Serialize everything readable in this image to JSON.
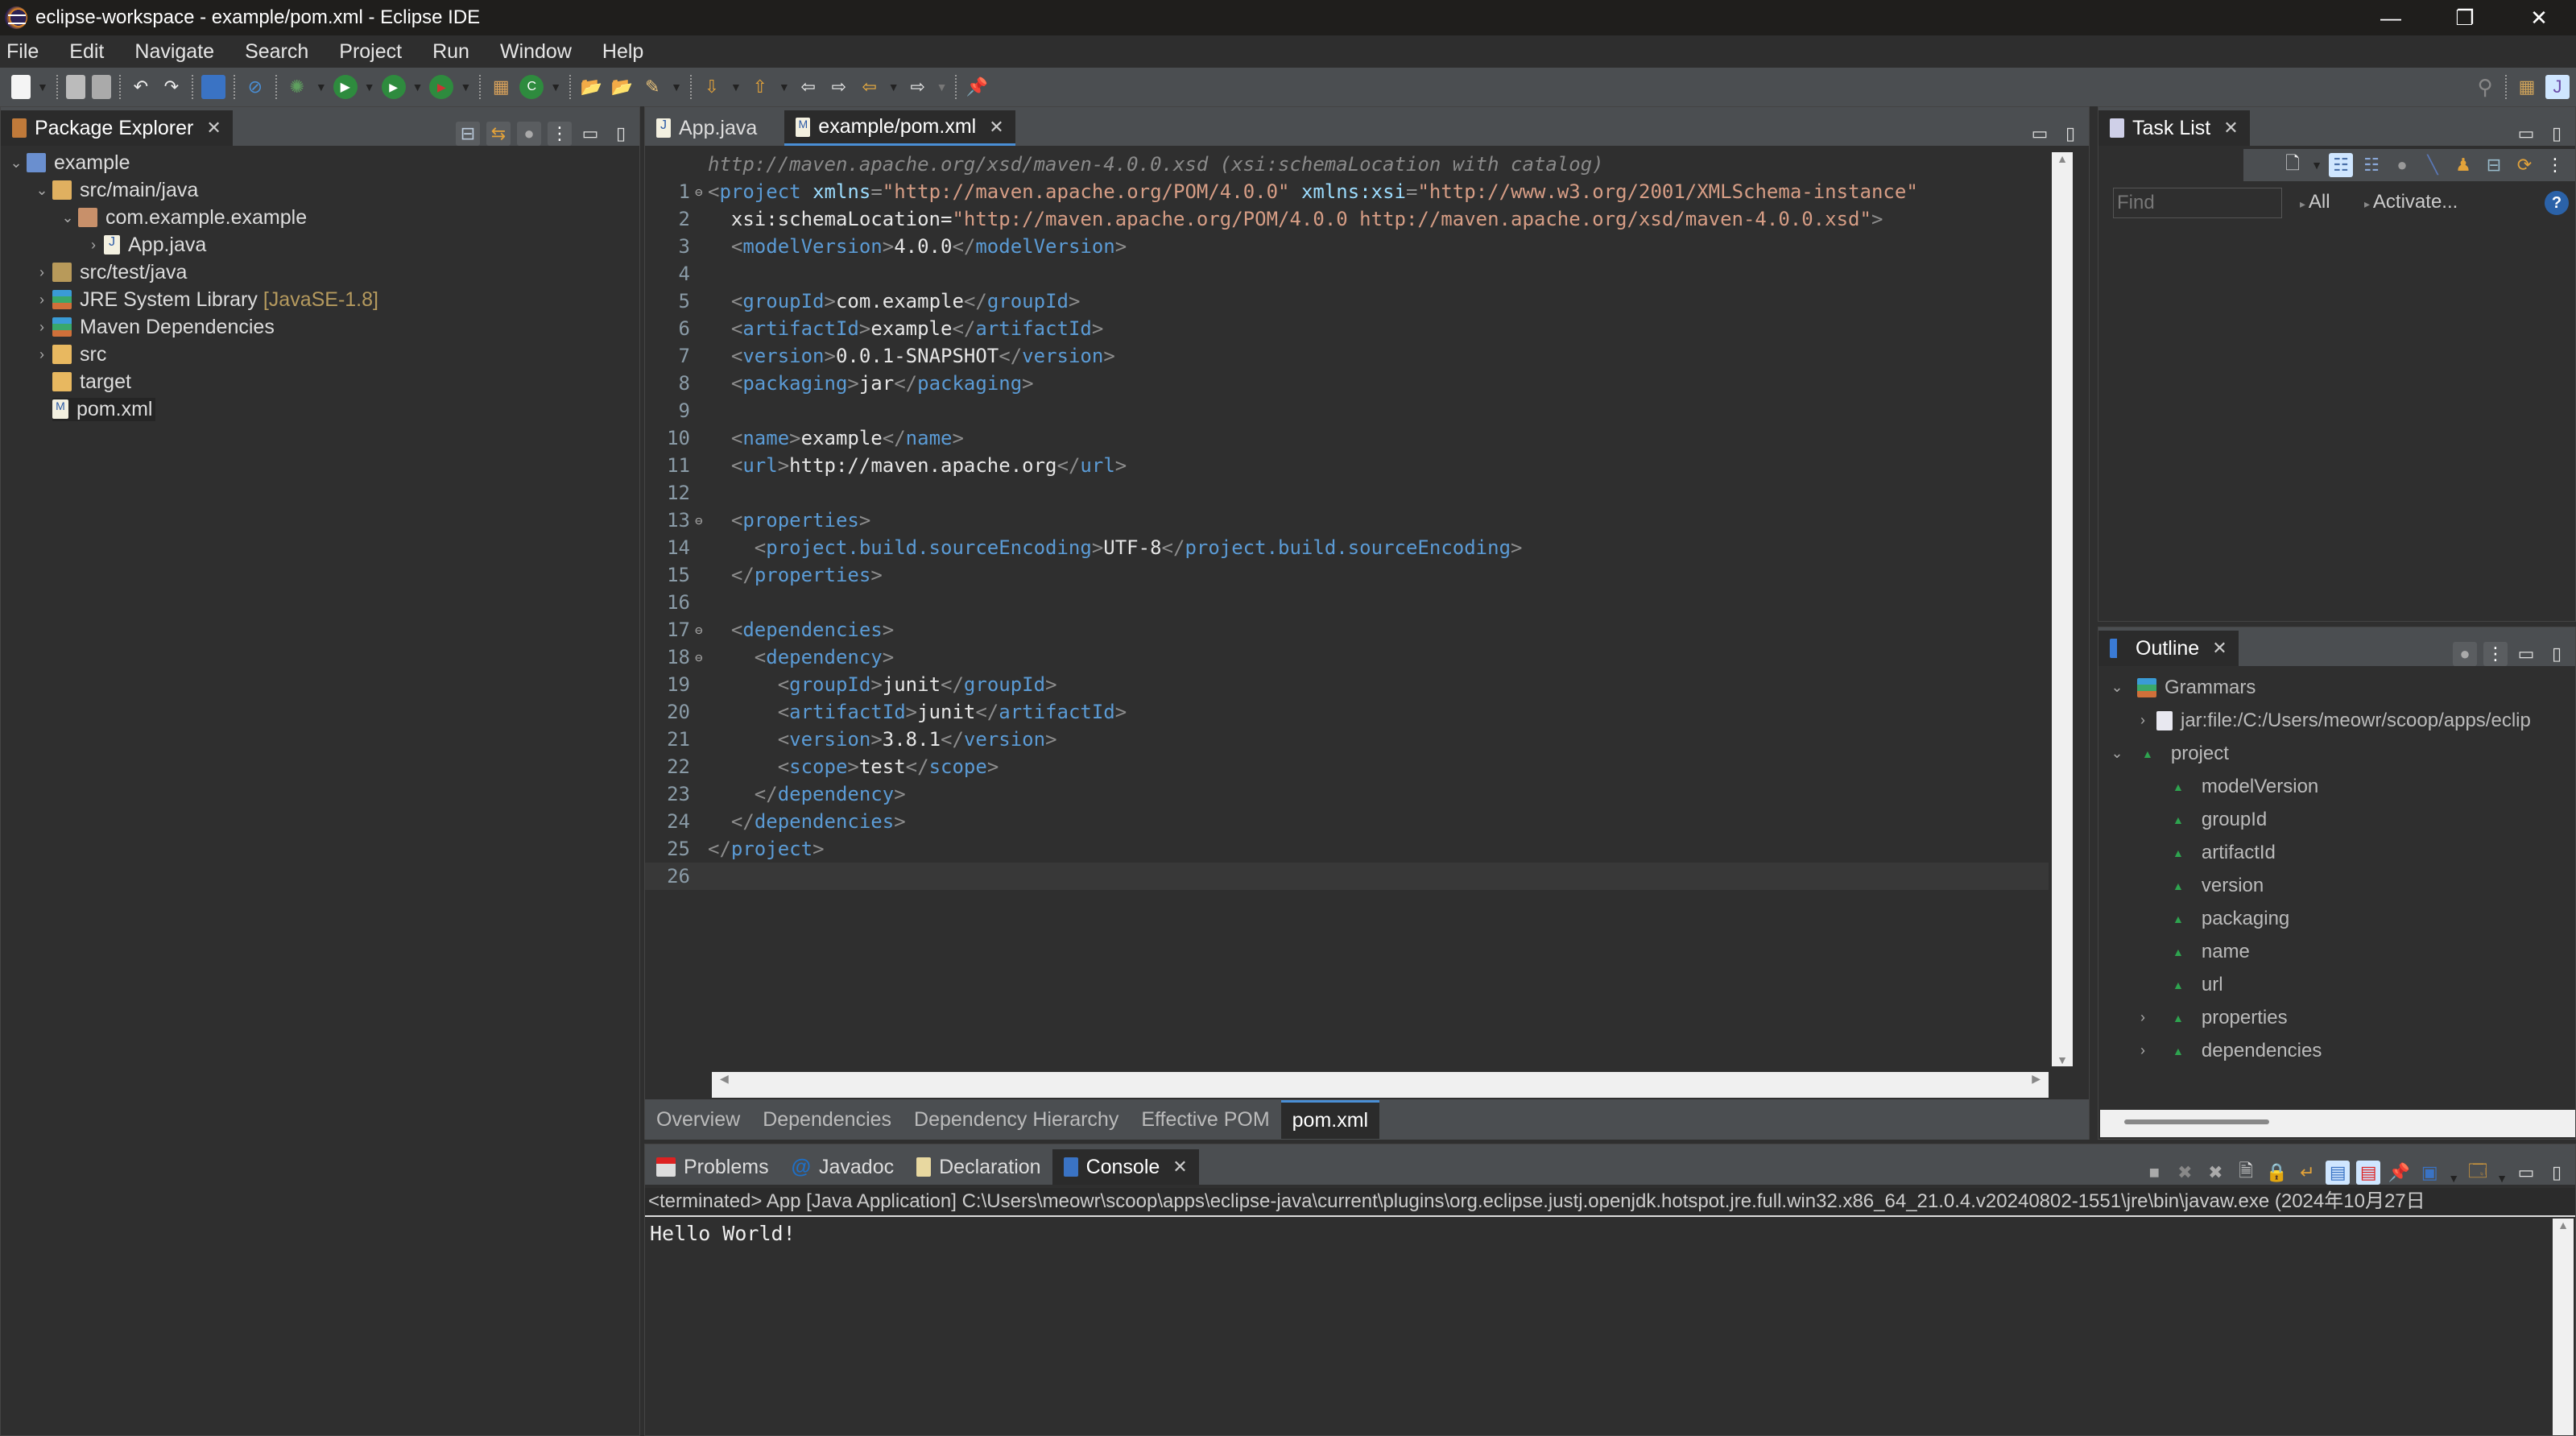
{
  "window": {
    "title": "eclipse-workspace - example/pom.xml - Eclipse IDE",
    "controls": [
      "minimize",
      "restore",
      "close"
    ]
  },
  "menu": [
    "File",
    "Edit",
    "Navigate",
    "Search",
    "Project",
    "Run",
    "Window",
    "Help"
  ],
  "package_explorer": {
    "tab": "Package Explorer",
    "tree": [
      {
        "label": "example",
        "level": 0,
        "expanded": true,
        "icon": "maven-project-icon"
      },
      {
        "label": "src/main/java",
        "level": 1,
        "expanded": true,
        "icon": "source-folder-icon"
      },
      {
        "label": "com.example.example",
        "level": 2,
        "expanded": true,
        "icon": "package-icon"
      },
      {
        "label": "App.java",
        "level": 3,
        "expanded": false,
        "icon": "java-file-icon"
      },
      {
        "label": "src/test/java",
        "level": 1,
        "expanded": false,
        "icon": "source-folder-icon"
      },
      {
        "label": "JRE System Library",
        "suffix": "[JavaSE-1.8]",
        "level": 1,
        "expanded": false,
        "icon": "library-icon"
      },
      {
        "label": "Maven Dependencies",
        "level": 1,
        "expanded": false,
        "icon": "library-icon"
      },
      {
        "label": "src",
        "level": 1,
        "expanded": false,
        "icon": "folder-icon"
      },
      {
        "label": "target",
        "level": 1,
        "icon": "folder-icon"
      },
      {
        "label": "pom.xml",
        "level": 1,
        "icon": "maven-file-icon",
        "selected": true
      }
    ]
  },
  "editor": {
    "tabs": [
      {
        "label": "App.java",
        "active": false
      },
      {
        "label": "example/pom.xml",
        "active": true
      }
    ],
    "schema_hint": "http://maven.apache.org/xsd/maven-4.0.0.xsd (xsi:schemaLocation with catalog)",
    "lines": [
      "<project xmlns=\"http://maven.apache.org/POM/4.0.0\" xmlns:xsi=\"http://www.w3.org/2001/XMLSchema-instance\"",
      "  xsi:schemaLocation=\"http://maven.apache.org/POM/4.0.0 http://maven.apache.org/xsd/maven-4.0.0.xsd\">",
      "  <modelVersion>4.0.0</modelVersion>",
      "",
      "  <groupId>com.example</groupId>",
      "  <artifactId>example</artifactId>",
      "  <version>0.0.1-SNAPSHOT</version>",
      "  <packaging>jar</packaging>",
      "",
      "  <name>example</name>",
      "  <url>http://maven.apache.org</url>",
      "",
      "  <properties>",
      "    <project.build.sourceEncoding>UTF-8</project.build.sourceEncoding>",
      "  </properties>",
      "",
      "  <dependencies>",
      "    <dependency>",
      "      <groupId>junit</groupId>",
      "      <artifactId>junit</artifactId>",
      "      <version>3.8.1</version>",
      "      <scope>test</scope>",
      "    </dependency>",
      "  </dependencies>",
      "</project>",
      ""
    ],
    "fold_lines": [
      1,
      13,
      17,
      18
    ],
    "bottom_tabs": [
      {
        "label": "Overview"
      },
      {
        "label": "Dependencies"
      },
      {
        "label": "Dependency Hierarchy"
      },
      {
        "label": "Effective POM"
      },
      {
        "label": "pom.xml",
        "active": true
      }
    ]
  },
  "task_list": {
    "tab": "Task List",
    "find_placeholder": "Find",
    "filter_all": "All",
    "activate": "Activate..."
  },
  "outline": {
    "tab": "Outline",
    "tree": [
      {
        "label": "Grammars",
        "level": 0,
        "expanded": true,
        "icon": "library-icon"
      },
      {
        "label": "jar:file:/C:/Users/meowr/scoop/apps/eclip",
        "level": 1,
        "expanded": false,
        "icon": "document-icon"
      },
      {
        "label": "project",
        "level": 0,
        "expanded": true,
        "icon": "element-icon"
      },
      {
        "label": "modelVersion",
        "level": 1,
        "icon": "element-icon"
      },
      {
        "label": "groupId",
        "level": 1,
        "icon": "element-icon"
      },
      {
        "label": "artifactId",
        "level": 1,
        "icon": "element-icon"
      },
      {
        "label": "version",
        "level": 1,
        "icon": "element-icon"
      },
      {
        "label": "packaging",
        "level": 1,
        "icon": "element-icon"
      },
      {
        "label": "name",
        "level": 1,
        "icon": "element-icon"
      },
      {
        "label": "url",
        "level": 1,
        "icon": "element-icon"
      },
      {
        "label": "properties",
        "level": 1,
        "expanded": false,
        "icon": "element-icon"
      },
      {
        "label": "dependencies",
        "level": 1,
        "expanded": false,
        "icon": "element-icon"
      }
    ]
  },
  "bottom": {
    "tabs": [
      {
        "label": "Problems"
      },
      {
        "label": "Javadoc"
      },
      {
        "label": "Declaration"
      },
      {
        "label": "Console",
        "active": true
      }
    ],
    "console_header": "<terminated> App [Java Application] C:\\Users\\meowr\\scoop\\apps\\eclipse-java\\current\\plugins\\org.eclipse.justj.openjdk.hotspot.jre.full.win32.x86_64_21.0.4.v20240802-1551\\jre\\bin\\javaw.exe  (2024年10月27日",
    "console_output": "Hello World!"
  }
}
